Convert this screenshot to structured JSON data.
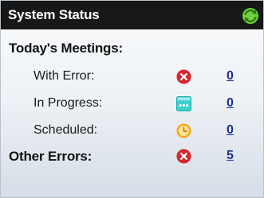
{
  "title": "System Status",
  "sections": {
    "today": {
      "label": "Today's Meetings:"
    },
    "other": {
      "label": "Other Errors:",
      "count": "5",
      "icon": "error-icon"
    }
  },
  "rows": [
    {
      "label": "With Error:",
      "count": "0",
      "icon": "error-icon"
    },
    {
      "label": "In Progress:",
      "count": "0",
      "icon": "in-progress-icon"
    },
    {
      "label": "Scheduled:",
      "count": "0",
      "icon": "clock-icon"
    }
  ],
  "colors": {
    "titlebar": "#181818",
    "error": "#d7262e",
    "progress": "#3fd0d0",
    "scheduled": "#f5a818",
    "link": "#1b2f96",
    "refresh": "#4caf2a"
  }
}
